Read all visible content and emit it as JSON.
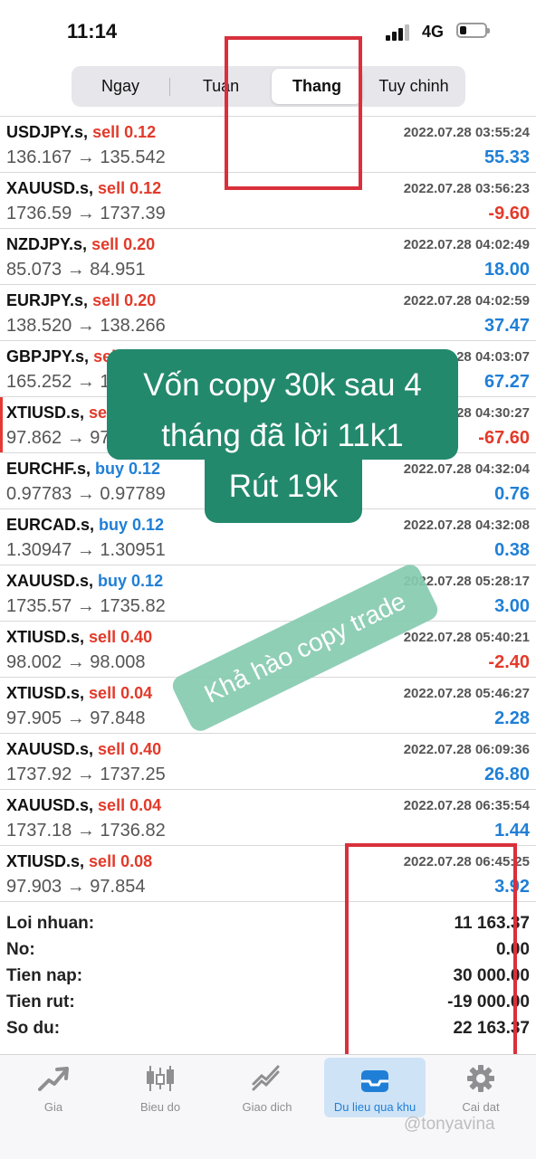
{
  "status_bar": {
    "time": "11:14",
    "network": "4G"
  },
  "period_tabs": [
    {
      "label": "Ngay",
      "active": false
    },
    {
      "label": "Tuan",
      "active": false
    },
    {
      "label": "Thang",
      "active": true
    },
    {
      "label": "Tuy chinh",
      "active": false
    }
  ],
  "trades": [
    {
      "symbol": "USDJPY.s,",
      "action": "sell 0.12",
      "side": "sell",
      "time": "2022.07.28 03:55:24",
      "prices": "136.167 → 135.542",
      "profit": "55.33",
      "sign": "pos"
    },
    {
      "symbol": "XAUUSD.s,",
      "action": "sell 0.12",
      "side": "sell",
      "time": "2022.07.28 03:56:23",
      "prices": "1736.59 → 1737.39",
      "profit": "-9.60",
      "sign": "neg"
    },
    {
      "symbol": "NZDJPY.s,",
      "action": "sell 0.20",
      "side": "sell",
      "time": "2022.07.28 04:02:49",
      "prices": "85.073 → 84.951",
      "profit": "18.00",
      "sign": "pos"
    },
    {
      "symbol": "EURJPY.s,",
      "action": "sell 0.20",
      "side": "sell",
      "time": "2022.07.28 04:02:59",
      "prices": "138.520 → 138.266",
      "profit": "37.47",
      "sign": "pos"
    },
    {
      "symbol": "GBPJPY.s,",
      "action": "sell 0.20",
      "side": "sell",
      "time": "2022.07.28 04:03:07",
      "prices": "165.252 → 164.920",
      "profit": "67.27",
      "sign": "pos"
    },
    {
      "symbol": "XTIUSD.s,",
      "action": "sell 0.40",
      "side": "sell",
      "time": "2022.07.28 04:30:27",
      "prices": "97.862 → 97.931",
      "profit": "-67.60",
      "sign": "neg",
      "marked": true
    },
    {
      "symbol": "EURCHF.s,",
      "action": "buy 0.12",
      "side": "buy",
      "time": "2022.07.28 04:32:04",
      "prices": "0.97783 → 0.97789",
      "profit": "0.76",
      "sign": "pos"
    },
    {
      "symbol": "EURCAD.s,",
      "action": "buy 0.12",
      "side": "buy",
      "time": "2022.07.28 04:32:08",
      "prices": "1.30947 → 1.30951",
      "profit": "0.38",
      "sign": "pos"
    },
    {
      "symbol": "XAUUSD.s,",
      "action": "buy 0.12",
      "side": "buy",
      "time": "2022.07.28 05:28:17",
      "prices": "1735.57 → 1735.82",
      "profit": "3.00",
      "sign": "pos"
    },
    {
      "symbol": "XTIUSD.s,",
      "action": "sell 0.40",
      "side": "sell",
      "time": "2022.07.28 05:40:21",
      "prices": "98.002 → 98.008",
      "profit": "-2.40",
      "sign": "neg"
    },
    {
      "symbol": "XTIUSD.s,",
      "action": "sell 0.04",
      "side": "sell",
      "time": "2022.07.28 05:46:27",
      "prices": "97.905 → 97.848",
      "profit": "2.28",
      "sign": "pos"
    },
    {
      "symbol": "XAUUSD.s,",
      "action": "sell 0.40",
      "side": "sell",
      "time": "2022.07.28 06:09:36",
      "prices": "1737.92 → 1737.25",
      "profit": "26.80",
      "sign": "pos"
    },
    {
      "symbol": "XAUUSD.s,",
      "action": "sell 0.04",
      "side": "sell",
      "time": "2022.07.28 06:35:54",
      "prices": "1737.18 → 1736.82",
      "profit": "1.44",
      "sign": "pos"
    },
    {
      "symbol": "XTIUSD.s,",
      "action": "sell 0.08",
      "side": "sell",
      "time": "2022.07.28 06:45:25",
      "prices": "97.903 → 97.854",
      "profit": "3.92",
      "sign": "pos"
    }
  ],
  "summary": [
    {
      "label": "Loi nhuan:",
      "value": "11 163.37"
    },
    {
      "label": "No:",
      "value": "0.00"
    },
    {
      "label": "Tien nap:",
      "value": "30 000.00"
    },
    {
      "label": "Tien rut:",
      "value": "-19 000.00"
    },
    {
      "label": "So du:",
      "value": "22 163.37"
    }
  ],
  "overlay": {
    "callout_lines": [
      "Vốn copy 30k sau 4",
      "tháng đã lời 11k1",
      "Rút 19k"
    ],
    "sticker": "Khả hào copy trade",
    "watermark": "@tonyavina"
  },
  "bottom_tabs": [
    {
      "label": "Gia",
      "icon": "trend-arrow-icon",
      "active": false
    },
    {
      "label": "Bieu do",
      "icon": "candlestick-icon",
      "active": false
    },
    {
      "label": "Giao dich",
      "icon": "trade-chart-icon",
      "active": false
    },
    {
      "label": "Du lieu qua khu",
      "icon": "history-tray-icon",
      "active": true
    },
    {
      "label": "Cai dat",
      "icon": "gear-icon",
      "active": false
    }
  ],
  "colors": {
    "sell": "#e23a2a",
    "buy": "#1f7fd6",
    "positive": "#1f7fd6",
    "negative": "#e23a2a",
    "callout": "#23896c",
    "sticker": "#86cbb0",
    "highlight_box": "#d9303c"
  }
}
